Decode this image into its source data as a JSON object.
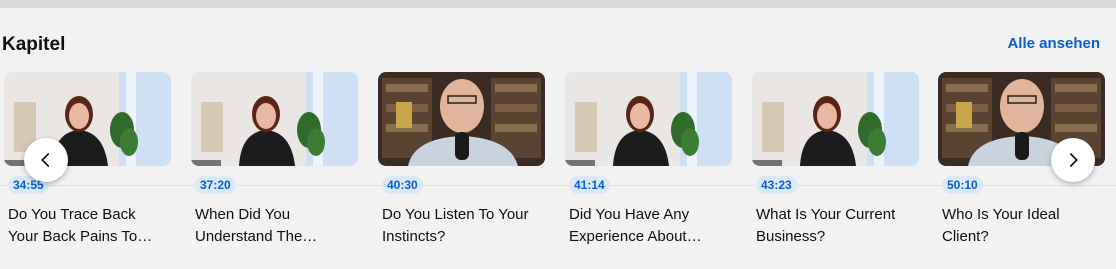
{
  "header": {
    "title": "Kapitel",
    "see_all": "Alle ansehen"
  },
  "chapters": [
    {
      "time": "34:55",
      "title": "Do You Trace Back Your Back Pains To…",
      "speaker": "woman"
    },
    {
      "time": "37:20",
      "title": "When Did You Understand The…",
      "speaker": "woman"
    },
    {
      "time": "40:30",
      "title": "Do You Listen To Your Instincts?",
      "speaker": "man"
    },
    {
      "time": "41:14",
      "title": "Did You Have Any Experience About…",
      "speaker": "woman"
    },
    {
      "time": "43:23",
      "title": "What Is Your Current Business?",
      "speaker": "woman"
    },
    {
      "time": "50:10",
      "title": "Who Is Your Ideal Client?",
      "speaker": "man"
    }
  ],
  "nav": {
    "prev_icon": "chevron-left-icon",
    "next_icon": "chevron-right-icon"
  },
  "colors": {
    "accent": "#065fd4",
    "background": "#f2f2f2"
  }
}
